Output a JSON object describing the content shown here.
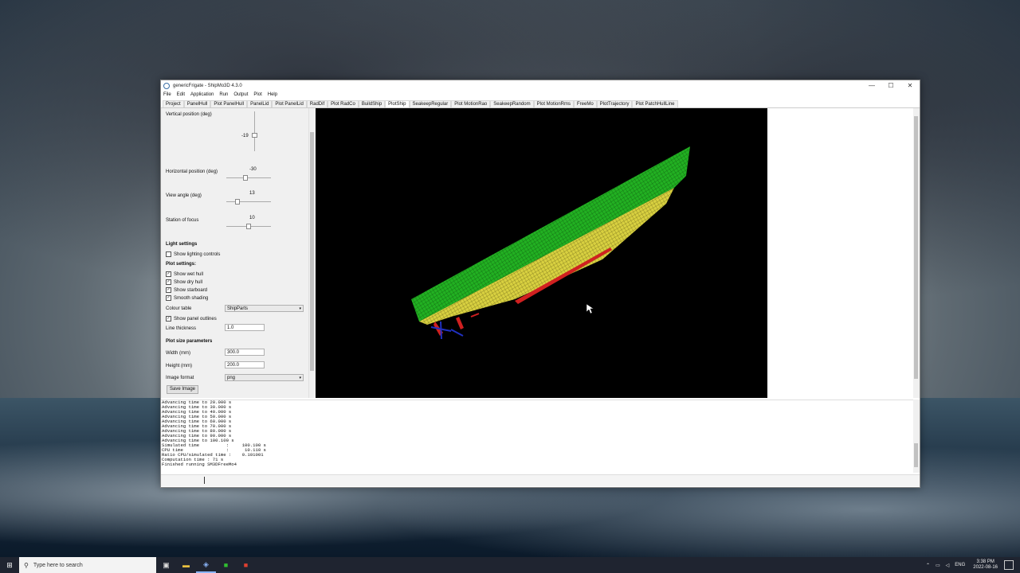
{
  "window": {
    "title": "genericFrigate - ShipMo3D 4.3.0",
    "controls": {
      "minimize": "—",
      "maximize": "☐",
      "close": "✕"
    }
  },
  "menu": [
    "File",
    "Edit",
    "Application",
    "Run",
    "Output",
    "Plot",
    "Help"
  ],
  "tabs": [
    "Project",
    "PanelHull",
    "Plot PanelHull",
    "PanelLid",
    "Plot PanelLid",
    "RadDif",
    "Plot RadCo",
    "BuildShip",
    "PlotShip",
    "SeakeepRegular",
    "Plot MotionRao",
    "SeakeepRandom",
    "Plot MotionRms",
    "FreeMo",
    "PlotTrajectory",
    "Plot PatchHullLine"
  ],
  "active_tab": "PlotShip",
  "panel": {
    "vertical_label": "Vertical position (deg)",
    "vertical_value": "-19",
    "horizontal_label": "Horizontal position (deg)",
    "horizontal_value": "-30",
    "view_angle_label": "View angle (deg)",
    "view_angle_value": "13",
    "station_label": "Station of focus",
    "station_value": "10",
    "light_settings": "Light settings",
    "show_lighting": "Show lighting controls",
    "plot_settings": "Plot settings:",
    "show_wet_hull": "Show wet hull",
    "show_dry_hull": "Show dry hull",
    "show_starboard": "Show starboard",
    "smooth_shading": "Smooth shading",
    "colour_table_label": "Colour table",
    "colour_table_value": "ShipParts",
    "show_panel_outlines": "Show panel outlines",
    "line_thickness_label": "Line thickness",
    "line_thickness_value": "1.0",
    "plot_size_params": "Plot size parameters",
    "width_label": "Width (mm)",
    "width_value": "300.0",
    "height_label": "Height (mm)",
    "height_value": "200.0",
    "image_format_label": "Image format",
    "image_format_value": "png",
    "save_image": "Save Image",
    "check_mark": "✓"
  },
  "colors": {
    "dry_hull": "#22b022",
    "wet_hull": "#d8d040",
    "appendage": "#d02020",
    "propeller": "#2030c0",
    "plot_bg": "#000000"
  },
  "console_lines": [
    "Advancing time to 20.000 s",
    "Advancing time to 30.000 s",
    "Advancing time to 40.000 s",
    "Advancing time to 50.000 s",
    "Advancing time to 60.000 s",
    "Advancing time to 70.000 s",
    "Advancing time to 80.000 s",
    "Advancing time to 90.000 s",
    "Advancing time to 100.100 s",
    "Simulated time          :     100.100 s",
    "CPU time                :      10.110 s",
    "Ratio CPU/simulated time :    0.101001",
    "Computation time : 71 s",
    "",
    "Finished running SM3DFreeMo4"
  ],
  "taskbar": {
    "search_placeholder": "Type here to search",
    "lang": "ENG",
    "time": "3:38 PM",
    "date": "2022-08-16"
  }
}
